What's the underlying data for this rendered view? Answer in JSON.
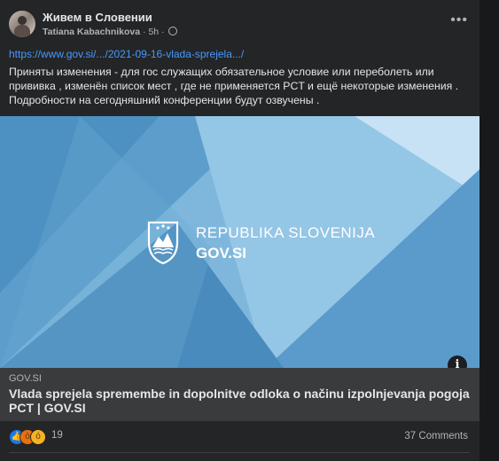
{
  "post": {
    "group_name": "Живем в Словении",
    "author": "Tatiana Kabachnikova",
    "time": "5h",
    "visibility_icon": "globe-icon",
    "more_icon": "more-options-icon",
    "link_url": "https://www.gov.si/.../2021-09-16-vlada-sprejela.../",
    "text": "Приняты изменения - для гос служащих обязательное условие или переболеть или прививка , изменён список мест , где не применяется  PCT и ещё некоторые изменения . Подробности на сегодняшний конференции будут озвучены ."
  },
  "preview": {
    "logo_line1": "REPUBLIKA SLOVENIJA",
    "logo_line2": "GOV.SI",
    "info_icon": "info-icon",
    "domain": "GOV.SI",
    "title": "Vlada sprejela spremembe in dopolnitve odloka o načinu izpolnjevanja pogoja PCT | GOV.SI"
  },
  "footer": {
    "reaction_icons": [
      "like-icon",
      "angry-icon",
      "sad-icon"
    ],
    "reaction_count": "19",
    "comments": "37 Comments"
  },
  "colors": {
    "background": "#242526",
    "link": "#4599ff",
    "preview_blue": "#6aa9d1"
  }
}
